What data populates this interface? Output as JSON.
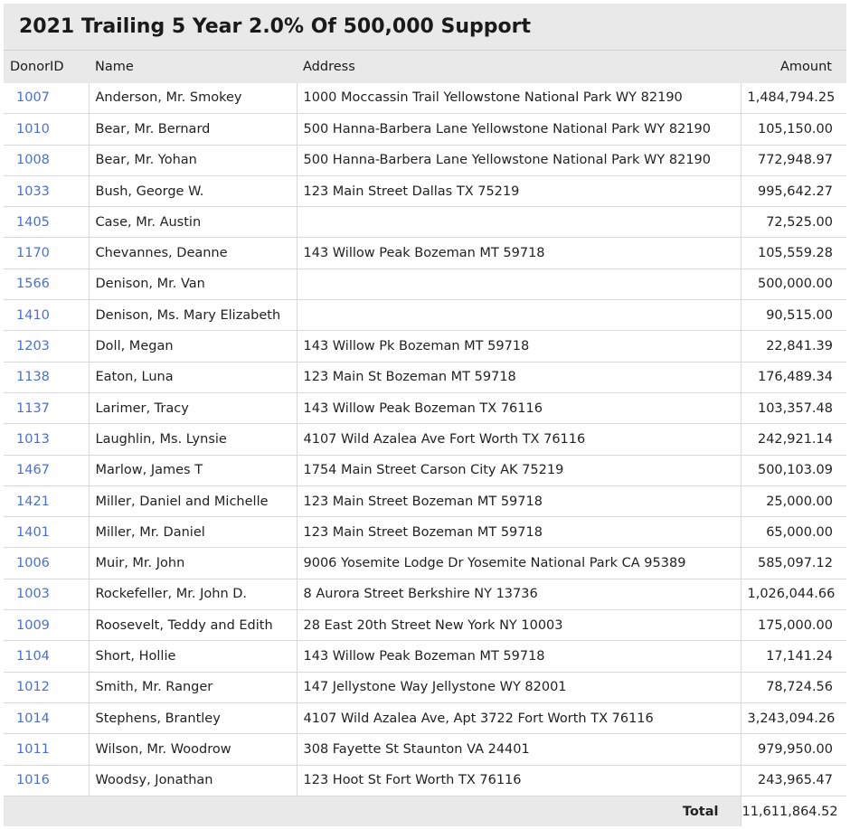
{
  "report": {
    "title": "2021 Trailing 5 Year 2.0% Of 500,000 Support",
    "columns": {
      "id": "DonorID",
      "name": "Name",
      "address": "Address",
      "amount": "Amount"
    },
    "rows": [
      {
        "id": "1007",
        "name": "Anderson, Mr. Smokey",
        "address": "1000 Moccassin Trail Yellowstone National Park WY 82190",
        "amount": "1,484,794.25"
      },
      {
        "id": "1010",
        "name": "Bear, Mr. Bernard",
        "address": "500 Hanna-Barbera Lane Yellowstone National Park WY 82190",
        "amount": "105,150.00"
      },
      {
        "id": "1008",
        "name": "Bear, Mr. Yohan",
        "address": "500 Hanna-Barbera Lane Yellowstone National Park WY 82190",
        "amount": "772,948.97"
      },
      {
        "id": "1033",
        "name": "Bush, George W.",
        "address": "123 Main Street Dallas TX 75219",
        "amount": "995,642.27"
      },
      {
        "id": "1405",
        "name": "Case, Mr. Austin",
        "address": "",
        "amount": "72,525.00"
      },
      {
        "id": "1170",
        "name": "Chevannes, Deanne",
        "address": "143 Willow Peak Bozeman MT 59718",
        "amount": "105,559.28"
      },
      {
        "id": "1566",
        "name": "Denison, Mr. Van",
        "address": "",
        "amount": "500,000.00"
      },
      {
        "id": "1410",
        "name": "Denison, Ms. Mary Elizabeth",
        "address": "",
        "amount": "90,515.00"
      },
      {
        "id": "1203",
        "name": "Doll, Megan",
        "address": "143 Willow Pk Bozeman MT 59718",
        "amount": "22,841.39"
      },
      {
        "id": "1138",
        "name": "Eaton, Luna",
        "address": "123 Main St Bozeman MT 59718",
        "amount": "176,489.34"
      },
      {
        "id": "1137",
        "name": "Larimer, Tracy",
        "address": "143 Willow Peak Bozeman TX 76116",
        "amount": "103,357.48"
      },
      {
        "id": "1013",
        "name": "Laughlin, Ms. Lynsie",
        "address": "4107 Wild Azalea Ave Fort Worth TX 76116",
        "amount": "242,921.14"
      },
      {
        "id": "1467",
        "name": "Marlow, James T",
        "address": "1754 Main Street Carson City AK 75219",
        "amount": "500,103.09"
      },
      {
        "id": "1421",
        "name": "Miller, Daniel and Michelle",
        "address": "123 Main Street Bozeman MT 59718",
        "amount": "25,000.00"
      },
      {
        "id": "1401",
        "name": "Miller, Mr. Daniel",
        "address": "123 Main Street Bozeman MT 59718",
        "amount": "65,000.00"
      },
      {
        "id": "1006",
        "name": "Muir, Mr. John",
        "address": "9006 Yosemite Lodge Dr Yosemite National Park CA 95389",
        "amount": "585,097.12"
      },
      {
        "id": "1003",
        "name": "Rockefeller, Mr. John D.",
        "address": "8 Aurora Street Berkshire NY 13736",
        "amount": "1,026,044.66"
      },
      {
        "id": "1009",
        "name": "Roosevelt, Teddy and Edith",
        "address": "28 East 20th Street New York NY 10003",
        "amount": "175,000.00"
      },
      {
        "id": "1104",
        "name": "Short, Hollie",
        "address": "143 Willow Peak Bozeman MT 59718",
        "amount": "17,141.24"
      },
      {
        "id": "1012",
        "name": "Smith, Mr. Ranger",
        "address": "147 Jellystone Way Jellystone WY 82001",
        "amount": "78,724.56"
      },
      {
        "id": "1014",
        "name": "Stephens, Brantley",
        "address": "4107 Wild Azalea Ave, Apt 3722 Fort Worth TX 76116",
        "amount": "3,243,094.26"
      },
      {
        "id": "1011",
        "name": "Wilson, Mr. Woodrow",
        "address": "308 Fayette St Staunton VA 24401",
        "amount": "979,950.00"
      },
      {
        "id": "1016",
        "name": "Woodsy, Jonathan",
        "address": "123 Hoot St Fort Worth TX 76116",
        "amount": "243,965.47"
      }
    ],
    "total_label": "Total",
    "total_value": "11,611,864.52"
  },
  "colors": {
    "link": "#4a6fd0",
    "header_bg": "#e9e9e9",
    "grid": "#d9d9d9"
  }
}
